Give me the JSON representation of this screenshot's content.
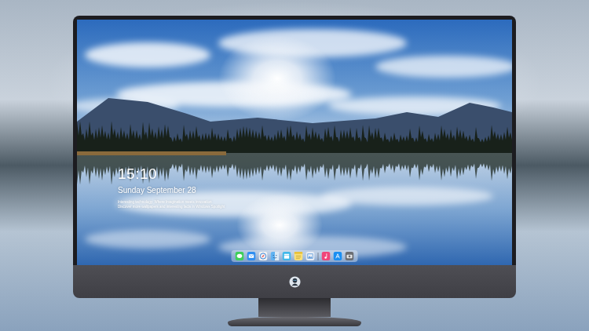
{
  "lock_screen": {
    "time": "15:10",
    "date": "Sunday September 28",
    "caption": [
      "Interesting technology: Where Imagination meets innovation",
      "Discover more wallpapers and interesting facts in Windows Spotlight"
    ]
  }
}
